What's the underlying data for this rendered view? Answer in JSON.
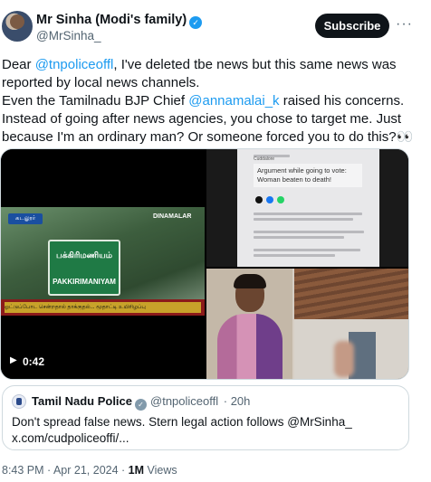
{
  "author": {
    "name": "Mr Sinha (Modi's family)",
    "handle": "@MrSinha_",
    "verified_icon": "verified-badge-icon"
  },
  "actions": {
    "subscribe_label": "Subscribe",
    "more_label": "···"
  },
  "tweet": {
    "line1_a": "Dear ",
    "line1_mention": "@tnpoliceoffl",
    "line1_b": ", I've deleted tbe news but this same news was reported by local news channels.",
    "line2_a": "Even the Tamilnadu BJP Chief ",
    "line2_mention": "@annamalai_k",
    "line2_b": " raised his concerns.",
    "line3": "Instead of going after news agencies, you chose to target me. Just because I'm an ordinary man? Or someone forced you to do this?👀"
  },
  "media": {
    "video": {
      "channel_logo": "கடலூர்",
      "corner_tag": "DINAMALAR",
      "sign_tamil": "பக்கிரிமணியம்",
      "sign_english": "PAKKIRIMANIYAM",
      "ticker": "ஓட்டுப்போட சென்றதால் தாக்குதல்... மூதாட்டி உயிரிழப்பு",
      "play_icon": "play-icon",
      "duration": "0:42"
    },
    "article": {
      "label": "Cuddalore",
      "headline": "Argument while going to vote: Woman beaten to death!"
    }
  },
  "quote": {
    "name": "Tamil Nadu Police",
    "handle": "@tnpoliceoffl",
    "time": "· 20h",
    "text_line1": "Don't spread false news.  Stern legal action follows @MrSinha_",
    "text_line2": "x.com/cudpoliceoffi/..."
  },
  "footer": {
    "timestamp": "8:43 PM · Apr 21, 2024 · ",
    "views_count": "1M",
    "views_label": " Views"
  },
  "colors": {
    "accent": "#1d9bf0",
    "text": "#0f1419",
    "muted": "#536471",
    "border": "#cfd9de"
  }
}
